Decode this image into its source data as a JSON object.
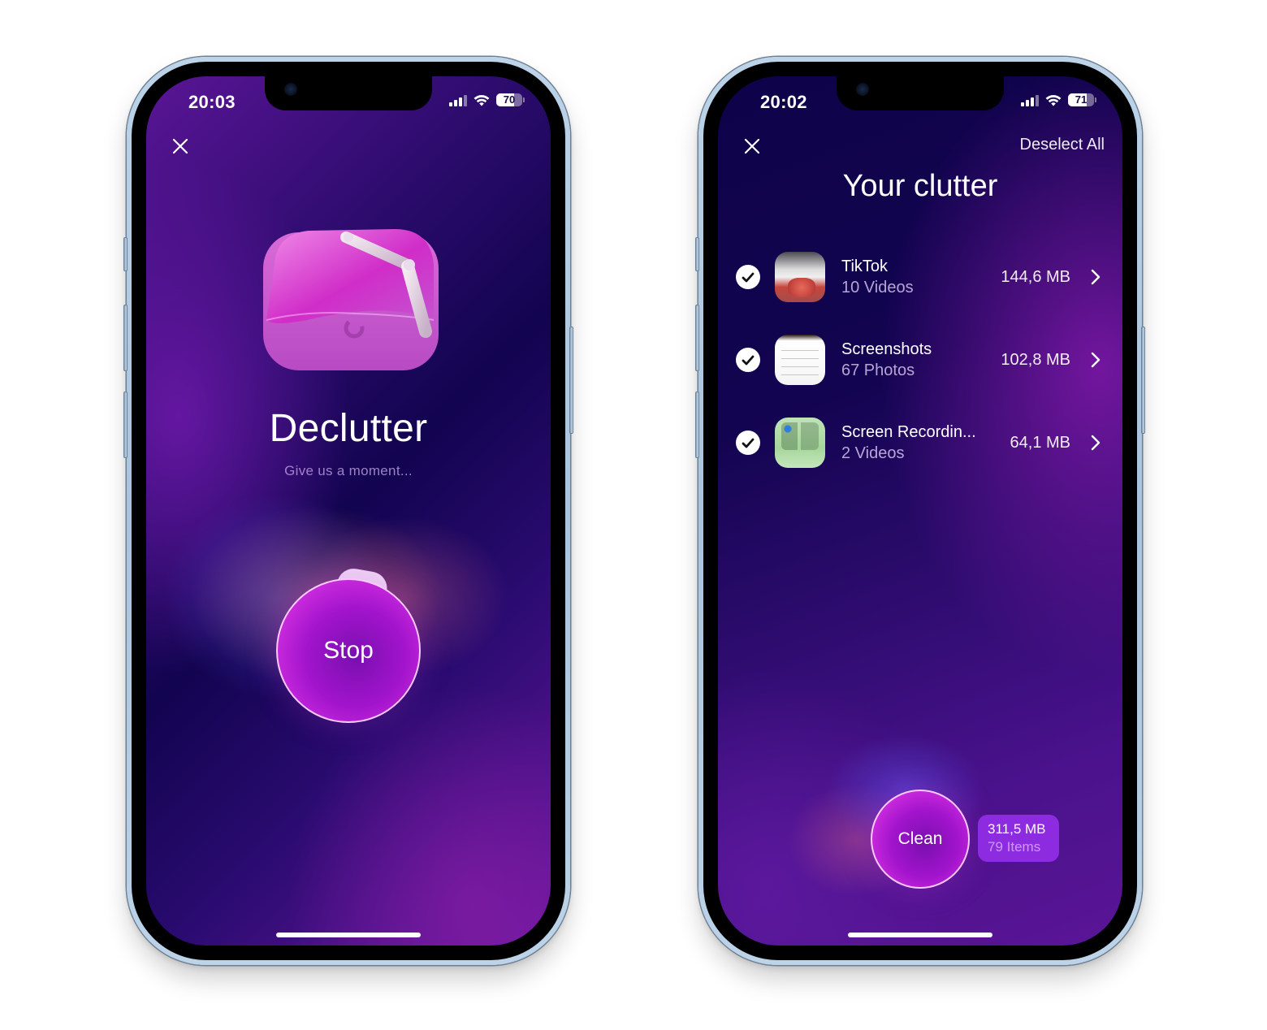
{
  "screens": [
    {
      "id": "scanning",
      "status_bar": {
        "time": "20:03",
        "battery": "70",
        "battery_level": 0.7,
        "signal_bars": 3,
        "signal_max": 4
      },
      "close_icon": "close-icon",
      "app_icon": "declutter-app-icon",
      "title": "Declutter",
      "subtitle": "Give us a moment...",
      "primary_button": "Stop"
    },
    {
      "id": "results",
      "status_bar": {
        "time": "20:02",
        "battery": "71",
        "battery_level": 0.71,
        "signal_bars": 3,
        "signal_max": 4
      },
      "close_icon": "close-icon",
      "deselect_all": "Deselect All",
      "title": "Your clutter",
      "items": [
        {
          "name": "TikTok",
          "count": "10 Videos",
          "size": "144,6 MB",
          "checked": true,
          "thumbnail": "tiktok-thumbnail"
        },
        {
          "name": "Screenshots",
          "count": "67 Photos",
          "size": "102,8 MB",
          "checked": true,
          "thumbnail": "screenshots-thumbnail"
        },
        {
          "name": "Screen Recordin...",
          "count": "2 Videos",
          "size": "64,1 MB",
          "checked": true,
          "thumbnail": "screen-recordings-thumbnail"
        }
      ],
      "primary_button": "Clean",
      "summary": {
        "size": "311,5 MB",
        "items": "79 Items"
      }
    }
  ],
  "colors": {
    "background_deep": "#120450",
    "background_purple": "#6a179e",
    "button_magenta": "#d22ee0",
    "badge_purple": "#8d2be0",
    "phone_frame": "#a9c4de"
  }
}
